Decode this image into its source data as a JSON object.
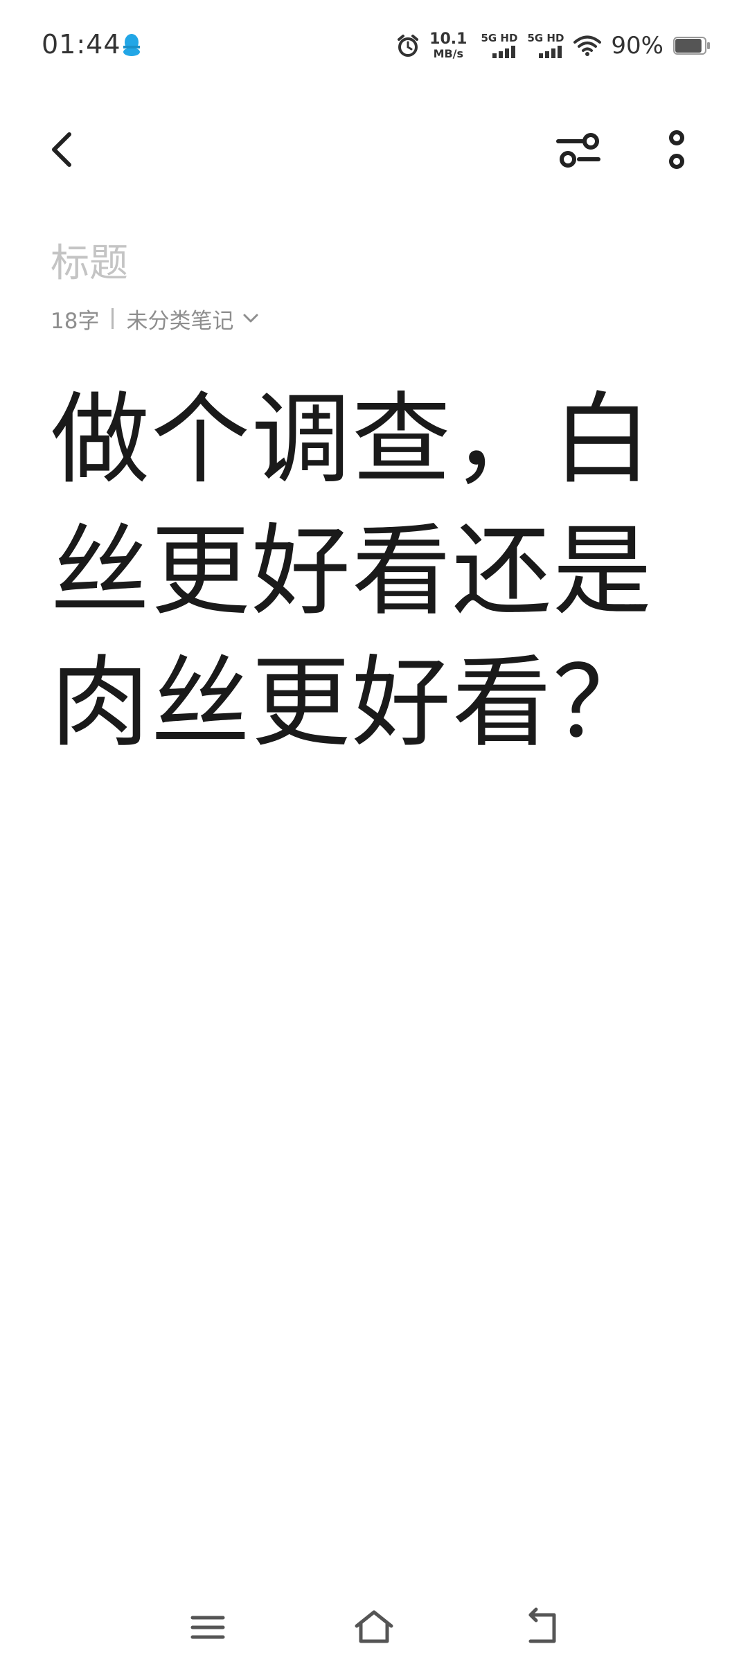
{
  "status_bar": {
    "time": "01:44",
    "net_speed_value": "10.1",
    "net_speed_unit": "MB/s",
    "sim1_label": "5G HD",
    "sim2_label": "5G HD",
    "battery_percent": "90%",
    "battery_level": 0.9,
    "icons": [
      "qq-icon",
      "alarm-icon",
      "signal-icon",
      "signal-icon",
      "wifi-icon",
      "battery-icon"
    ]
  },
  "toolbar": {
    "icons": [
      "back-arrow-icon",
      "sliders-icon",
      "more-vertical-icon"
    ]
  },
  "note": {
    "title_placeholder": "标题",
    "word_count": "18字",
    "category": "未分类笔记",
    "body": "做个调查，白丝更好看还是肉丝更好看？"
  },
  "nav_bar": {
    "icons": [
      "menu-icon",
      "home-icon",
      "return-icon"
    ]
  }
}
